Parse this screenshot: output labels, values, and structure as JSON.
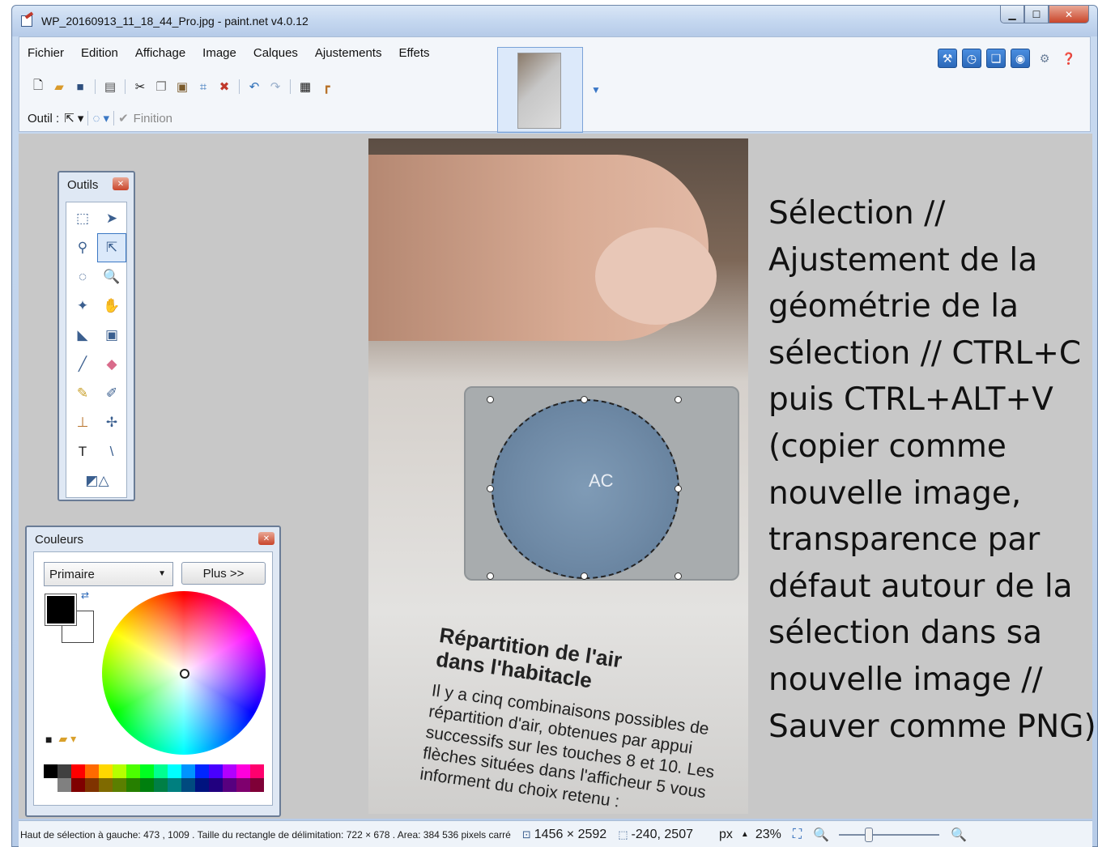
{
  "window": {
    "title": "WP_20160913_11_18_44_Pro.jpg - paint.net v4.0.12",
    "min_glyph": "▁",
    "max_glyph": "☐",
    "close_glyph": "✕"
  },
  "menubar": {
    "items": [
      {
        "label": "Fichier"
      },
      {
        "label": "Edition"
      },
      {
        "label": "Affichage"
      },
      {
        "label": "Image"
      },
      {
        "label": "Calques"
      },
      {
        "label": "Ajustements"
      },
      {
        "label": "Effets"
      }
    ]
  },
  "toolbar": {
    "icons": [
      "new-icon",
      "open-icon",
      "save-icon",
      "print-icon",
      "cut-icon",
      "copy-icon",
      "paste-icon",
      "crop-icon",
      "deselect-icon",
      "undo-icon",
      "redo-icon",
      "grid-icon",
      "ruler-icon"
    ]
  },
  "optbar": {
    "tool_label": "Outil :",
    "finition_label": "Finition"
  },
  "right_icons": [
    "tools-window-icon",
    "history-window-icon",
    "layers-window-icon",
    "colors-window-icon",
    "settings-icon",
    "help-icon"
  ],
  "tools_palette": {
    "title": "Outils",
    "tools": [
      "rectangle-select",
      "move-selection",
      "lasso-select",
      "move-selected-pixels",
      "ellipse-select",
      "zoom",
      "magic-wand",
      "pan",
      "paint-bucket",
      "gradient",
      "paintbrush",
      "eraser",
      "pencil",
      "color-picker",
      "clone-stamp",
      "recolor",
      "text",
      "line-curve",
      "shapes"
    ]
  },
  "colors_palette": {
    "title": "Couleurs",
    "select_value": "Primaire",
    "more_button": "Plus >>",
    "primary_color": "#000000",
    "secondary_color": "#ffffff"
  },
  "canvas": {
    "photo_heading_1": "Répartition de l'air",
    "photo_heading_2": "dans l'habitacle",
    "photo_body": [
      "Il y a cinq combinaisons possibles de",
      "répartition d'air, obtenues par appui",
      "successifs sur les touches 8 et 10. Les",
      "flèches situées dans l'afficheur 5 vous",
      "informent du choix retenu :"
    ],
    "dial_label": "AC"
  },
  "caption": "Sélection // Ajustement de la géométrie de la sélection // CTRL+C puis CTRL+ALT+V (copier comme nouvelle image, transparence par défaut autour de la sélection dans sa nouvelle image // Sauver comme PNG)",
  "statusbar": {
    "selection_info": "Haut de sélection à gauche: 473 , 1009 . Taille du rectangle de délimitation: 722  × 678 . Area: 384 536 pixels carré",
    "image_size": "1456 × 2592",
    "cursor_position": "-240, 2507",
    "units": "px",
    "zoom": "23%",
    "zoom_level": 0.23
  }
}
